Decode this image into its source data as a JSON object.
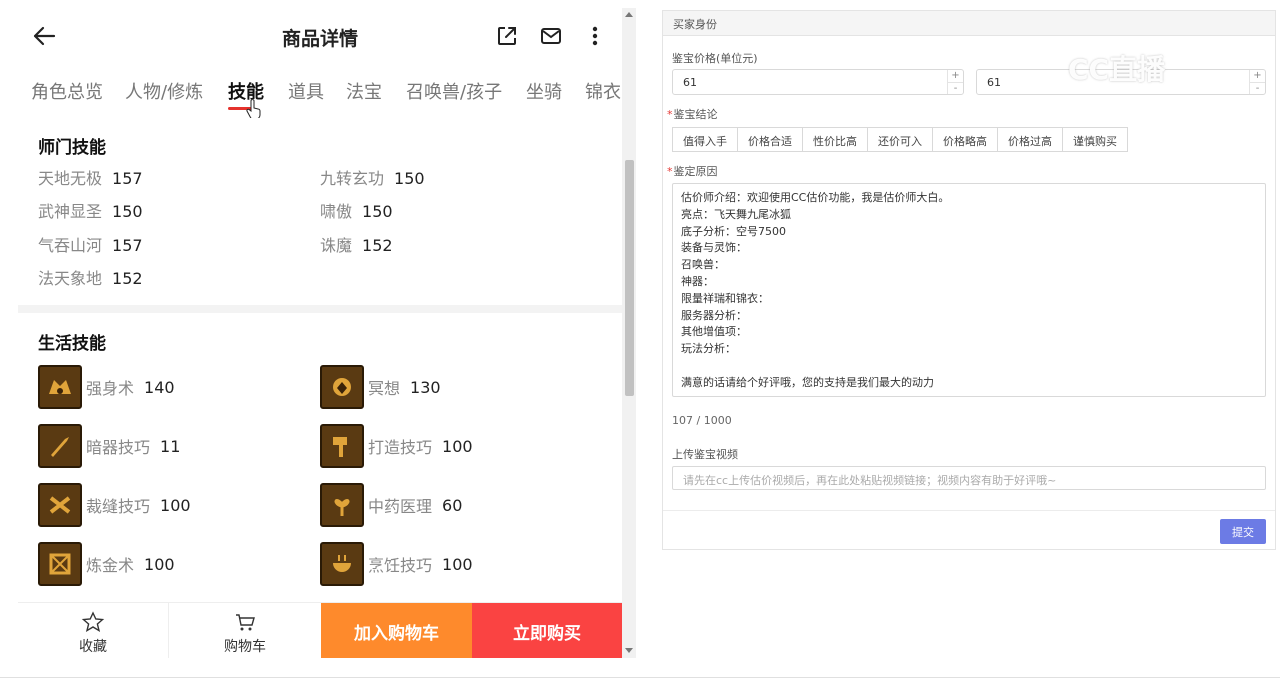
{
  "header": {
    "title": "商品详情"
  },
  "tabs": [
    {
      "label": "角色总览"
    },
    {
      "label": "人物/修炼"
    },
    {
      "label": "技能"
    },
    {
      "label": "道具"
    },
    {
      "label": "法宝"
    },
    {
      "label": "召唤兽/孩子"
    },
    {
      "label": "坐骑"
    },
    {
      "label": "锦衣"
    }
  ],
  "shimen": {
    "title": "师门技能",
    "skills": [
      {
        "name": "天地无极",
        "level": "157"
      },
      {
        "name": "九转玄功",
        "level": "150"
      },
      {
        "name": "武神显圣",
        "level": "150"
      },
      {
        "name": "啸傲",
        "level": "150"
      },
      {
        "name": "气吞山河",
        "level": "157"
      },
      {
        "name": "诛魔",
        "level": "152"
      },
      {
        "name": "法天象地",
        "level": "152"
      }
    ]
  },
  "life": {
    "title": "生活技能",
    "skills": [
      {
        "name": "强身术",
        "level": "140",
        "icon": "strength-icon"
      },
      {
        "name": "冥想",
        "level": "130",
        "icon": "meditation-icon"
      },
      {
        "name": "暗器技巧",
        "level": "11",
        "icon": "dart-icon"
      },
      {
        "name": "打造技巧",
        "level": "100",
        "icon": "hammer-icon"
      },
      {
        "name": "裁缝技巧",
        "level": "100",
        "icon": "scissors-icon"
      },
      {
        "name": "中药医理",
        "level": "60",
        "icon": "herb-icon"
      },
      {
        "name": "炼金术",
        "level": "100",
        "icon": "alchemy-icon"
      },
      {
        "name": "烹饪技巧",
        "level": "100",
        "icon": "cooking-icon"
      }
    ]
  },
  "bottom_bar": {
    "favorite": "收藏",
    "cart": "购物车",
    "add_cart": "加入购物车",
    "buy_now": "立即购买"
  },
  "panel": {
    "header": "买家身份",
    "price_label": "鉴宝价格(单位元)",
    "price_min": "61",
    "price_max": "61",
    "conclusion_label": "鉴宝结论",
    "conclusions": [
      "值得入手",
      "价格合适",
      "性价比高",
      "还价可入",
      "价格略高",
      "价格过高",
      "谨慎购买"
    ],
    "reason_label": "鉴定原因",
    "reason_lines": [
      "估价师介绍：欢迎使用CC估价功能，我是估价师大白。",
      "亮点：飞天舞九尾冰狐",
      "底子分析：空号7500",
      "装备与灵饰：",
      "召唤兽：",
      "神器：",
      "限量祥瑞和锦衣：",
      "服务器分析：",
      "其他增值项：",
      "玩法分析：",
      "",
      "满意的话请给个好评哦，您的支持是我们最大的动力"
    ],
    "counter": "107 / 1000",
    "video_label": "上传鉴宝视频",
    "video_placeholder": "请先在cc上传估价视频后，再在此处粘贴视频链接；视频内容有助于好评哦~",
    "submit": "提交"
  },
  "watermark": "CC直播",
  "colors": {
    "accent_red": "#e5322d",
    "cart_orange": "#fe8a2c",
    "buy_red": "#fa4342",
    "submit_blue": "#6c7be5"
  }
}
